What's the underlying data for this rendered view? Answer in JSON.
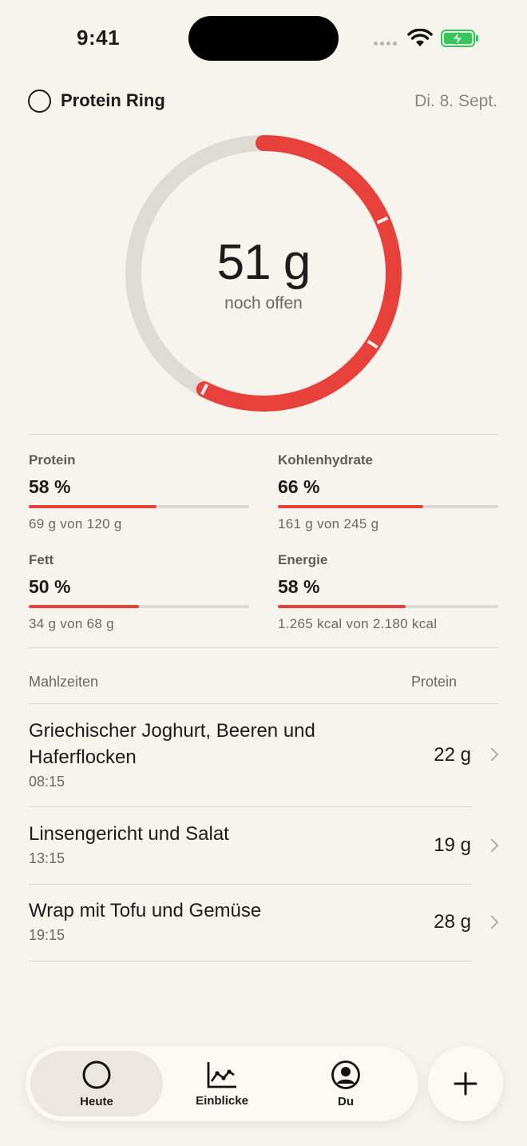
{
  "status": {
    "time": "9:41"
  },
  "header": {
    "title": "Protein Ring",
    "date": "Di. 8. Sept."
  },
  "ring": {
    "value": "51 g",
    "subtitle": "noch offen",
    "consumed_fraction": 0.575,
    "accent": "#e8403a",
    "track": "#dedad4"
  },
  "macros": [
    {
      "label": "Protein",
      "percent": "58 %",
      "fraction": 0.58,
      "detail": "69 g von 120 g"
    },
    {
      "label": "Kohlenhydrate",
      "percent": "66 %",
      "fraction": 0.66,
      "detail": "161 g von 245 g"
    },
    {
      "label": "Fett",
      "percent": "50 %",
      "fraction": 0.5,
      "detail": "34 g von 68 g"
    },
    {
      "label": "Energie",
      "percent": "58 %",
      "fraction": 0.58,
      "detail": "1.265 kcal von 2.180 kcal"
    }
  ],
  "meals": {
    "header_left": "Mahlzeiten",
    "header_right": "Protein",
    "items": [
      {
        "name": "Griechischer Joghurt, Beeren und Haferflocken",
        "time": "08:15",
        "protein": "22 g"
      },
      {
        "name": "Linsengericht und Salat",
        "time": "13:15",
        "protein": "19 g"
      },
      {
        "name": "Wrap mit Tofu und Gemüse",
        "time": "19:15",
        "protein": "28 g"
      }
    ]
  },
  "tabs": [
    {
      "label": "Heute",
      "icon": "ring-icon",
      "active": true
    },
    {
      "label": "Einblicke",
      "icon": "chart-icon",
      "active": false
    },
    {
      "label": "Du",
      "icon": "profile-icon",
      "active": false
    }
  ],
  "fab": {
    "icon": "plus-icon"
  }
}
